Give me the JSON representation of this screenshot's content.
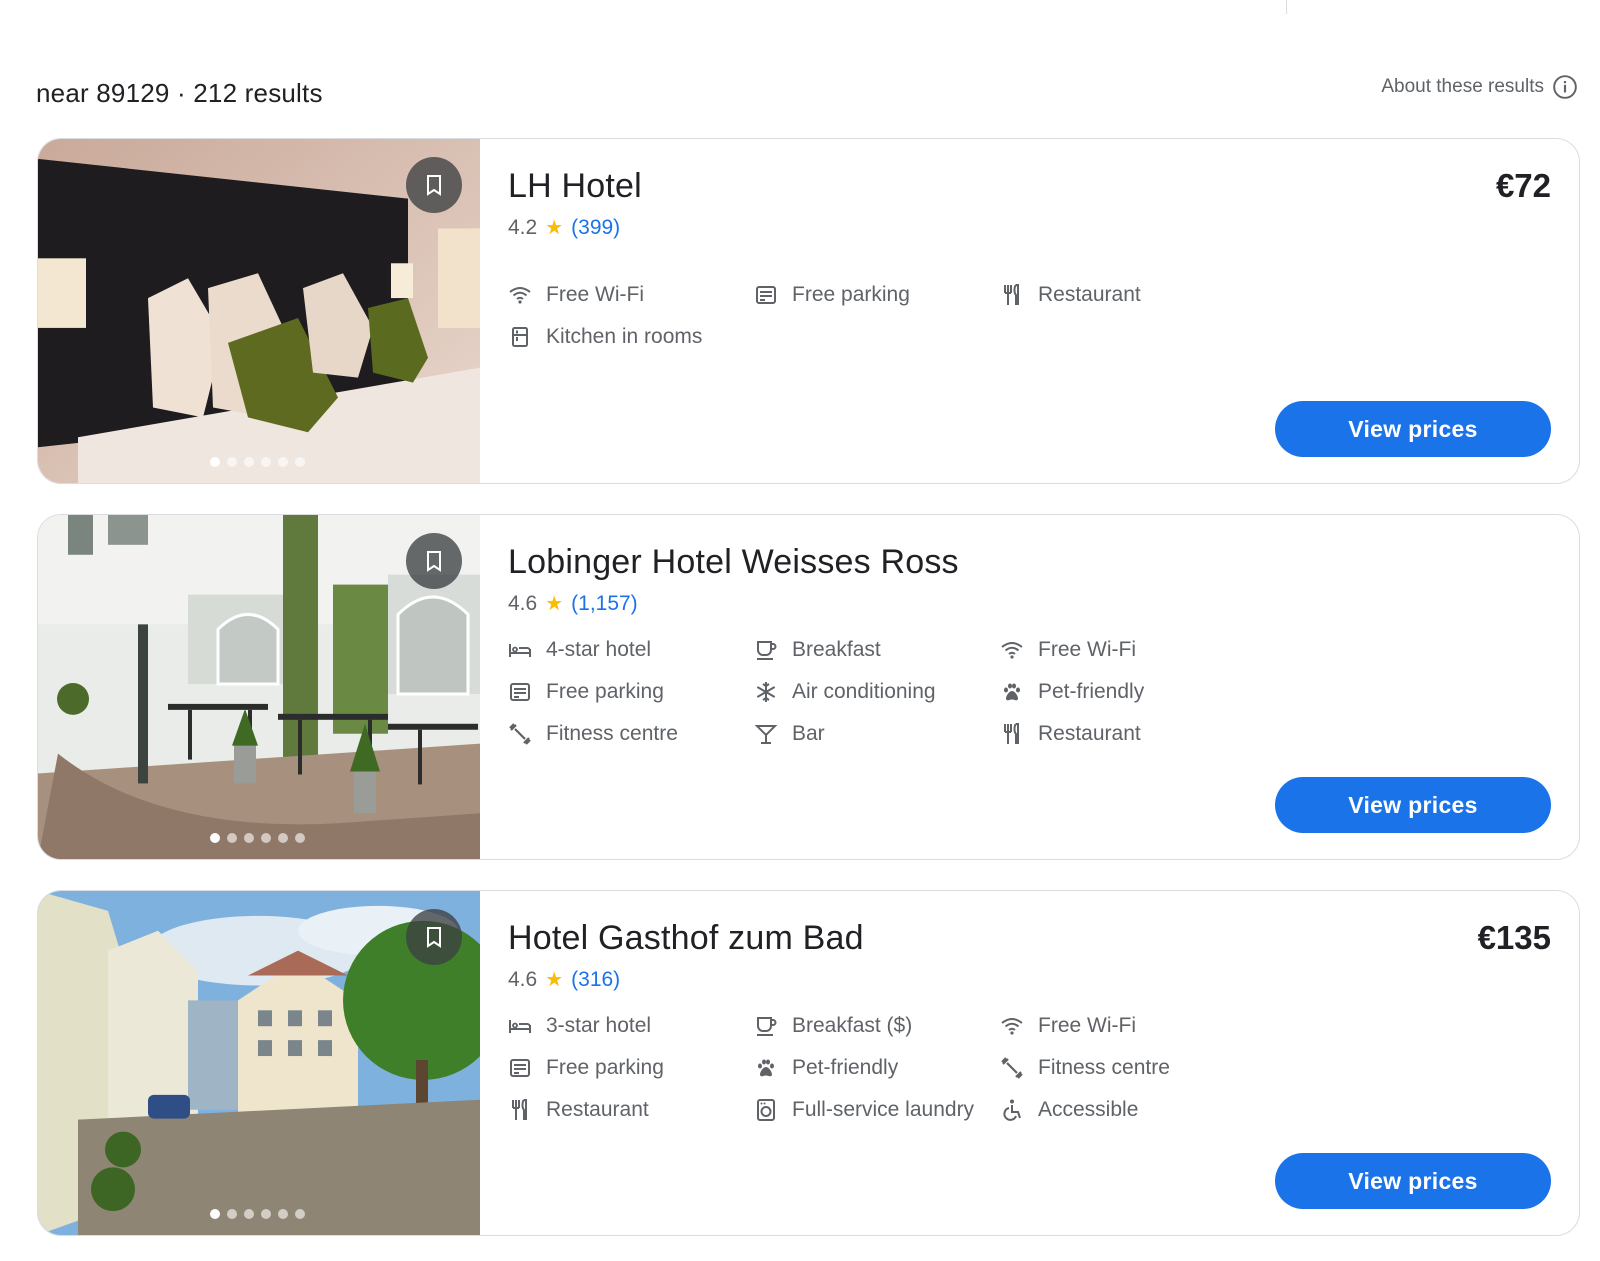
{
  "results_header": {
    "summary": "near 89129 · 212 results",
    "about_label": "About these results"
  },
  "hotels": [
    {
      "name": "LH Hotel",
      "price": "€72",
      "rating": "4.2",
      "reviews": "(399)",
      "photo_count": 6,
      "active_photo": 0,
      "amenities": [
        {
          "label": "Free Wi-Fi",
          "icon": "wifi-icon"
        },
        {
          "label": "Free parking",
          "icon": "parking-icon"
        },
        {
          "label": "Restaurant",
          "icon": "restaurant-icon"
        },
        {
          "label": "Kitchen in rooms",
          "icon": "kitchen-icon"
        }
      ],
      "view_prices_label": "View prices"
    },
    {
      "name": "Lobinger Hotel Weisses Ross",
      "price": "",
      "rating": "4.6",
      "reviews": "(1,157)",
      "photo_count": 6,
      "active_photo": 0,
      "amenities": [
        {
          "label": "4-star hotel",
          "icon": "bed-icon"
        },
        {
          "label": "Breakfast",
          "icon": "coffee-icon"
        },
        {
          "label": "Free Wi-Fi",
          "icon": "wifi-icon"
        },
        {
          "label": "Free parking",
          "icon": "parking-icon"
        },
        {
          "label": "Air conditioning",
          "icon": "snowflake-icon"
        },
        {
          "label": "Pet-friendly",
          "icon": "paw-icon"
        },
        {
          "label": "Fitness centre",
          "icon": "fitness-icon"
        },
        {
          "label": "Bar",
          "icon": "cocktail-icon"
        },
        {
          "label": "Restaurant",
          "icon": "restaurant-icon"
        }
      ],
      "view_prices_label": "View prices"
    },
    {
      "name": "Hotel Gasthof zum Bad",
      "price": "€135",
      "rating": "4.6",
      "reviews": "(316)",
      "photo_count": 6,
      "active_photo": 0,
      "amenities": [
        {
          "label": "3-star hotel",
          "icon": "bed-icon"
        },
        {
          "label": "Breakfast ($)",
          "icon": "coffee-icon"
        },
        {
          "label": "Free Wi-Fi",
          "icon": "wifi-icon"
        },
        {
          "label": "Free parking",
          "icon": "parking-icon"
        },
        {
          "label": "Pet-friendly",
          "icon": "paw-icon"
        },
        {
          "label": "Fitness centre",
          "icon": "fitness-icon"
        },
        {
          "label": "Restaurant",
          "icon": "restaurant-icon"
        },
        {
          "label": "Full-service laundry",
          "icon": "laundry-icon"
        },
        {
          "label": "Accessible",
          "icon": "accessible-icon"
        }
      ],
      "view_prices_label": "View prices"
    }
  ],
  "colors": {
    "accent": "#1a73e8",
    "star": "#fbbc04",
    "muted_text": "#5f6368",
    "border": "#dadce0"
  }
}
